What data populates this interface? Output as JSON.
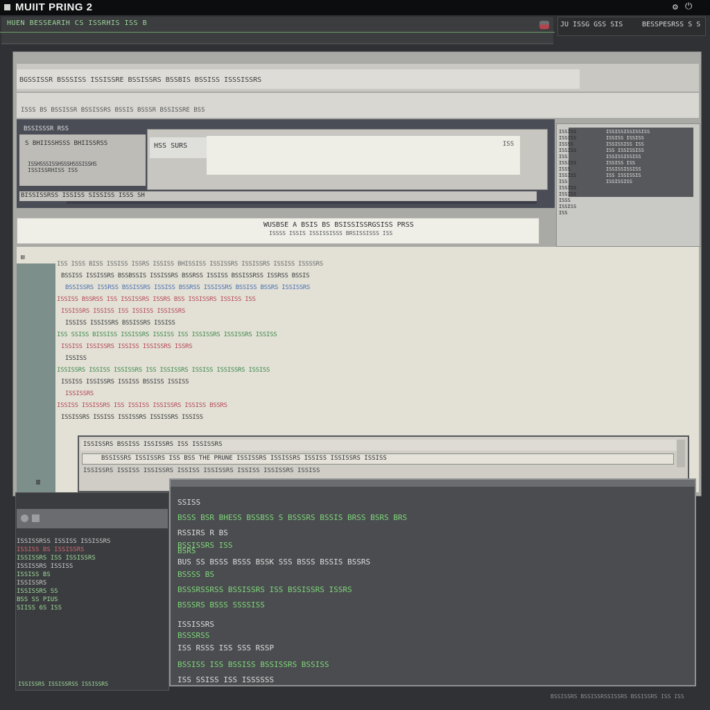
{
  "window": {
    "title": "MUIIT PRING 2",
    "controls": [
      "settings-icon",
      "power-icon"
    ],
    "control_glyphs": [
      "⚙",
      "⏻"
    ]
  },
  "status": {
    "left": "HUEN BESSEARIH  CS  ISSRHIS  ISS  B",
    "right_a": "JU  ISSG  GSS  SIS",
    "right_b": "BESSPESRSS  S  S"
  },
  "header": {
    "line1": "BGSSISSR  BSSSISS  ISSISSRE  BSSISSRS  BSSBIS  BSSISS  ISSSISSRS",
    "line2": "ISSS  BS  BSSISSR  BSSISSRS  BSSIS  BSSSR  BSSISSRE  BSS"
  },
  "slate": {
    "label": "BSSISSSR  RSS",
    "inner": [
      "S BHIISSHSSS BHIISSRSS",
      "ISSHSSSISSHSSSHSSSISSHS",
      "ISSISSRHISS  ISS"
    ],
    "dialog_field": "HSS  SURS",
    "dialog_mark": "ISS",
    "bar": "BISSISSRSS  ISSISS  SISSISS  ISSS  SH"
  },
  "thumb": {
    "col_a": "ISSISS\nISSISS\nISSSS\nISSISS\nISS\nISSISS\nISSS\nISSISS\nISS\nISSISS\nISSISS\nISSS\nISSISS\nISS",
    "col_b": "ISSISSISSISSISS\nISSISS ISSISS\nISSISSISS ISS\nISS ISSISSISS\nISSISSISSISS\nISSISS ISS\nISSISSISSISS\nISS ISSISSIS\nISSISSISS"
  },
  "info": {
    "title": "WUSBSE  A  BSIS  BS  BSISSISSRGSISS  PRSS",
    "sub": "ISSSS  ISSIS  ISSISSISSS  BRSISSISSS  ISS"
  },
  "editor": {
    "gutter_top": "▤",
    "lines": [
      {
        "t": "ISS  ISSS  BISS  ISSISS  ISSRS  ISSISS  BHISSISS  ISSISSRS  ISSISSRS  ISSISS  ISSSSRS",
        "c": "c-dim"
      },
      {
        "t": "BSSISS  ISSISSRS  BSSBSSIS  ISSISSRS  BSSRSS  ISSISS  BSSISSRSS  ISSRSS  BSSIS",
        "c": ""
      },
      {
        "t": "BSSISSRS  ISSRSS  BSSISSRS  ISSISS  BSSRSS  ISSISSRS  BSSISS  BSSRS  ISSISSRS",
        "c": "c-blu"
      },
      {
        "t": "ISSISS  BSSRSS  ISS  ISSISSRS  ISSRS  BSS  ISSISSRS  ISSISS  ISS",
        "c": "c-red"
      },
      {
        "t": "ISSISSRS  ISSISS  ISS  ISSISS  ISSISSRS",
        "c": "c-red"
      },
      {
        "t": "ISSISS  ISSISSRS  BSSISSRS  ISSISS",
        "c": ""
      },
      {
        "t": "ISS  SSISS  BISSISS  ISSISSRS  ISSISS  ISS  ISSISSRS  ISSISSRS  ISSISS",
        "c": "c-grn"
      },
      {
        "t": "ISSISS  ISSISSRS  ISSISS  ISSISSRS  ISSRS",
        "c": "c-red"
      },
      {
        "t": "ISSISS",
        "c": ""
      },
      {
        "t": "ISSISSRS  ISSISS  ISSISSRS  ISS  ISSISSRS  ISSISS  ISSISSRS  ISSISS",
        "c": "c-grn"
      },
      {
        "t": "ISSISS  ISSISSRS  ISSISS  BSSISS  ISSISS",
        "c": ""
      },
      {
        "t": "ISSISSRS",
        "c": "c-red"
      },
      {
        "t": "ISSISS  ISSISSRS  ISS  ISSISS  ISSISSRS  ISSISS  BSSRS",
        "c": "c-red"
      },
      {
        "t": "ISSISSRS  ISSISS  ISSISSRS  ISSISSRS  ISSISS",
        "c": ""
      }
    ],
    "tab_head": "ISSISSRS  BSSISS  ISSISSRS  ISS  ISSISSRS",
    "tab_row1": "BSSISSRS  ISSISSRS  ISS  BSS  THE  PRUNE  ISSISSRS  ISSISSRS  ISSISS  ISSISSRS  ISSISS",
    "tab_row2": "ISSISSRS  ISSISS  ISSISSRS  ISSISS  ISSISSRS  ISSISS  ISSISSRS  ISSISS",
    "gutter_btm": "▥"
  },
  "left_panel": {
    "items": [
      {
        "t": "ISSISSRSS  ISSISS  ISSISSRS",
        "c": "#c9c9c9"
      },
      {
        "t": "ISSISS  BS  ISSISSRS",
        "c": "#d06a72"
      },
      {
        "t": "ISSISSRS  ISS  ISSISSRS",
        "c": "#9fd89a"
      },
      {
        "t": "ISSISSRS  ISSISS",
        "c": "#c9c9c9"
      },
      {
        "t": "ISSISS  BS",
        "c": "#9fd89a"
      },
      {
        "t": "ISSISSRS",
        "c": "#c9c9c9"
      },
      {
        "t": "ISSISSRS  SS",
        "c": "#9fd89a"
      },
      {
        "t": "BSS  SS  PIUS",
        "c": "#9fd89a"
      },
      {
        "t": "SIISS  6S  ISS",
        "c": "#9fd89a"
      }
    ]
  },
  "terminal": {
    "lines": [
      {
        "t": "SSISS",
        "c": "tw"
      },
      {
        "t": "BSSS  BSR  BHESS  BSSBSS  S  BSSSRS  BSSIS  BRSS  BSRS  BRS",
        "c": "tg"
      },
      {
        "t": "  RSSIRS  R  BS",
        "c": "tw"
      },
      {
        "t": "             BSSISSRS  ISS",
        "c": "tg"
      },
      {
        "t": "  BSRS",
        "c": "tg"
      },
      {
        "t": "BUS  SS  BSSS  BSSS  BSSK  SSS  BSSS  BSSIS  BSSRS",
        "c": "tw"
      },
      {
        "t": "BSSSS  BS",
        "c": "tg"
      },
      {
        "t": "BSSSRSSRSS  BSSISSRS  ISS  BSSISSRS  ISSRS",
        "c": "tg"
      },
      {
        "t": "BSSSRS  BSSS  SSSSISS",
        "c": "tg"
      },
      {
        "t": "ISSISSRS",
        "c": "tw"
      },
      {
        "t": "BSSSRSS",
        "c": "tg"
      },
      {
        "t": "ISS  RSSS  ISS  SSS  RSSP",
        "c": "tw"
      },
      {
        "t": "BSSISS  ISS  BSSISS  BSSISSRS  BSSISS",
        "c": "tg"
      },
      {
        "t": "ISS  SSISS  ISS  ISSSSSS",
        "c": "tw"
      }
    ]
  },
  "footer": {
    "left": "ISSISSRS  ISSISSRSS  ISSISSRS",
    "right": "BSSISSRS  BSSISSRSSISSRS  BSSISSRS  ISS  ISS"
  },
  "colors": {
    "accent_green": "#7fd67a",
    "accent_red": "#b4444c",
    "terminal_bg": "#4a4c4f",
    "editor_bg": "#e3e1d5"
  }
}
